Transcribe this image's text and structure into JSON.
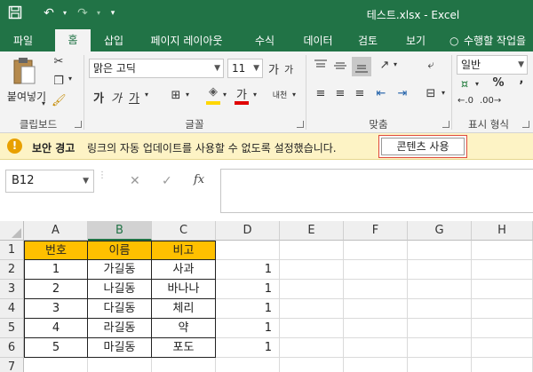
{
  "window": {
    "title": "테스트.xlsx - Excel"
  },
  "quick_access": {
    "save_icon": "save-icon",
    "undo_icon": "undo-icon",
    "redo_icon": "redo-icon",
    "customize_icon": "customize-icon"
  },
  "tabs": [
    {
      "label": "파일"
    },
    {
      "label": "홈"
    },
    {
      "label": "삽입"
    },
    {
      "label": "페이지 레이아웃"
    },
    {
      "label": "수식"
    },
    {
      "label": "데이터"
    },
    {
      "label": "검토"
    },
    {
      "label": "보기"
    },
    {
      "label": "수행할 작업을"
    }
  ],
  "ribbon": {
    "clipboard": {
      "paste_label": "붙여넣기",
      "group_label": "클립보드"
    },
    "font": {
      "name": "맑은 고딕",
      "size": "11",
      "group_label": "글꼴",
      "grow": "가",
      "shrink": "가",
      "bold": "가",
      "italic": "가",
      "underline": "가",
      "font_color": "가",
      "phonetic": "내천"
    },
    "alignment": {
      "group_label": "맞춤"
    },
    "number": {
      "format": "일반",
      "group_label": "표시 형식",
      "percent": "%",
      "comma": ","
    }
  },
  "security_bar": {
    "title": "보안 경고",
    "message": "링크의 자동 업데이트를 사용할 수 없도록 설정했습니다.",
    "button_label": "콘텐츠 사용"
  },
  "formula_bar": {
    "name_box": "B12",
    "fx": "fx",
    "cancel": "✕",
    "enter": "✓",
    "value": ""
  },
  "grid": {
    "columns": [
      "A",
      "B",
      "C",
      "D",
      "E",
      "F",
      "G",
      "H"
    ],
    "rows": [
      "1",
      "2",
      "3",
      "4",
      "5",
      "6",
      "7"
    ],
    "selected_column": "B",
    "header_row": [
      "번호",
      "이름",
      "비고"
    ],
    "data": [
      [
        "1",
        "가길동",
        "사과",
        "1"
      ],
      [
        "2",
        "나길동",
        "바나나",
        "1"
      ],
      [
        "3",
        "다길동",
        "체리",
        "1"
      ],
      [
        "4",
        "라길동",
        "약",
        "1"
      ],
      [
        "5",
        "마길동",
        "포도",
        "1"
      ]
    ]
  },
  "colors": {
    "excel_green": "#217346",
    "header_fill": "#ffc000",
    "security_bar": "#fdf3c5",
    "enable_button_border": "#e04a3a"
  }
}
